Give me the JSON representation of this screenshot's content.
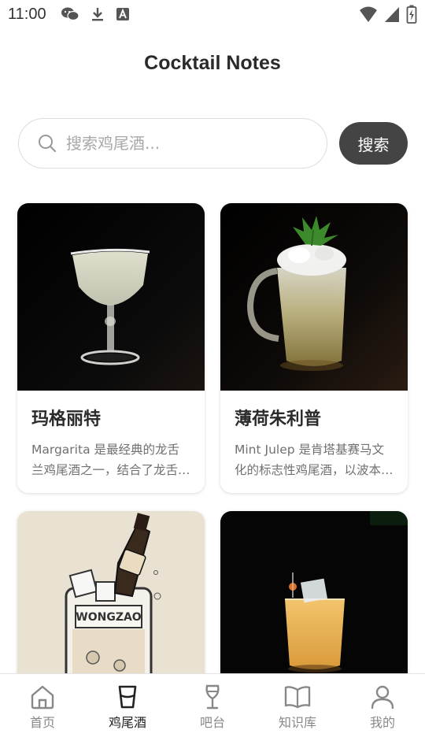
{
  "status_bar": {
    "time": "11:00",
    "icons": [
      "wechat-icon",
      "download-icon",
      "font-app-icon",
      "wifi-icon",
      "signal-icon",
      "battery-icon"
    ]
  },
  "header": {
    "title": "Cocktail Notes"
  },
  "search": {
    "placeholder": "搜索鸡尾酒...",
    "value": "",
    "button_label": "搜索"
  },
  "cocktails": [
    {
      "name": "玛格丽特",
      "description": "Margarita 是最经典的龙舌兰鸡尾酒之一，结合了龙舌兰酒、青柠汁与橙味利口酒。",
      "image_icon": "margarita-glass-image"
    },
    {
      "name": "薄荷朱利普",
      "description": "Mint Julep 是肯塔基赛马文化的标志性鸡尾酒，以波本威士忌和新鲜薄荷调制。",
      "image_icon": "mint-julep-mug-image"
    },
    {
      "name": "",
      "description": "",
      "image_icon": "baileys-milk-image",
      "label_text": "WONGZAO"
    },
    {
      "name": "",
      "description": "",
      "image_icon": "rocks-glass-cocktail-image"
    }
  ],
  "bottom_nav": {
    "items": [
      {
        "label": "首页",
        "icon": "home-icon",
        "active": false
      },
      {
        "label": "鸡尾酒",
        "icon": "cocktail-glass-icon",
        "active": true
      },
      {
        "label": "吧台",
        "icon": "wine-glass-icon",
        "active": false
      },
      {
        "label": "知识库",
        "icon": "book-icon",
        "active": false
      },
      {
        "label": "我的",
        "icon": "person-icon",
        "active": false
      }
    ]
  },
  "colors": {
    "accent_dark": "#444444",
    "nav_active": "#222222",
    "nav_inactive": "#888888"
  }
}
